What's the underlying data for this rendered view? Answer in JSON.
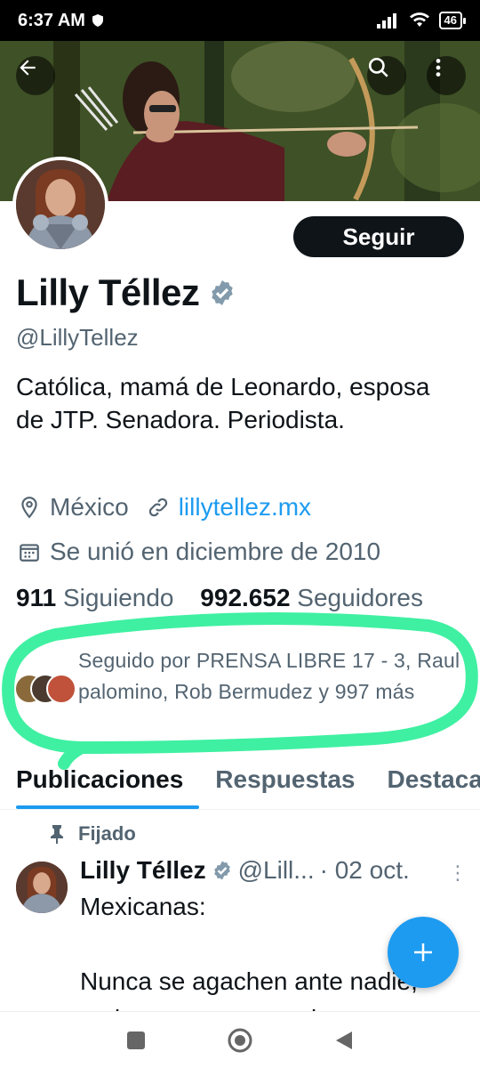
{
  "status_bar": {
    "time": "6:37 AM",
    "battery": "46"
  },
  "profile": {
    "name": "Lilly Téllez",
    "handle": "@LillyTellez",
    "follow_label": "Seguir",
    "bio": "Católica, mamá de Leonardo, esposa de JTP. Senadora. Periodista.",
    "location": "México",
    "website": "lillytellez.mx",
    "joined": "Se unió en diciembre de 2010",
    "following_count": "911",
    "following_label": "Siguiendo",
    "followers_count": "992.652",
    "followers_label": "Seguidores",
    "followed_by": "Seguido por PRENSA LIBRE 17 - 3, Raul palomino, Rob Bermudez y 997 más"
  },
  "tabs": [
    {
      "label": "Publicaciones",
      "active": true
    },
    {
      "label": "Respuestas",
      "active": false
    },
    {
      "label": "Destacados",
      "active": false
    }
  ],
  "pinned_tweet": {
    "pinned_label": "Fijado",
    "author": "Lilly Téllez",
    "handle": "@Lill...",
    "date": "· 02 oct.",
    "text": "Mexicanas:\n\nNunca se agachen ante nadie,\nno hagan manos sucias, no"
  },
  "colors": {
    "accent": "#1d9bf0",
    "highlight": "#3ff0a2",
    "verified": "#829aab"
  },
  "icons": [
    "back-arrow-icon",
    "search-icon",
    "more-vertical-icon",
    "verified-badge-icon",
    "location-pin-icon",
    "link-icon",
    "calendar-icon",
    "pin-icon",
    "plus-icon"
  ]
}
